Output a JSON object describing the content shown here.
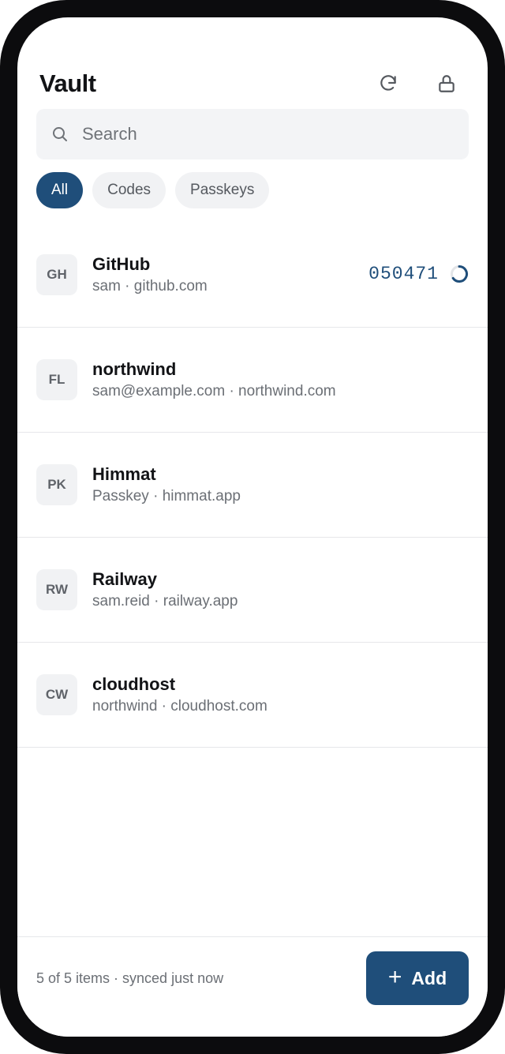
{
  "app": {
    "title": "Vault"
  },
  "search": {
    "placeholder": "Search"
  },
  "filters": [
    {
      "label": "All",
      "active": true
    },
    {
      "label": "Codes",
      "active": false
    },
    {
      "label": "Passkeys",
      "active": false
    }
  ],
  "items": [
    {
      "initials": "GH",
      "name": "GitHub",
      "subtitle": "sam · github.com",
      "code": "050471"
    },
    {
      "initials": "FL",
      "name": "northwind",
      "subtitle": "sam@example.com · northwind.com"
    },
    {
      "initials": "PK",
      "name": "Himmat",
      "subtitle": "Passkey · himmat.app"
    },
    {
      "initials": "RW",
      "name": "Railway",
      "subtitle": "sam.reid · railway.app"
    },
    {
      "initials": "CW",
      "name": "cloudhost",
      "subtitle": "northwind · cloudhost.com"
    }
  ],
  "footer": {
    "status": "5 of 5 items · synced just now",
    "add_label": "Add"
  },
  "colors": {
    "accent": "#1f4e7a",
    "frame": "#0c0c0e",
    "chip_bg": "#f1f2f4"
  },
  "icons": {
    "refresh": "refresh-icon",
    "lock": "lock-icon",
    "search": "search-icon",
    "plus": "plus-icon",
    "timer": "countdown-ring-icon"
  }
}
